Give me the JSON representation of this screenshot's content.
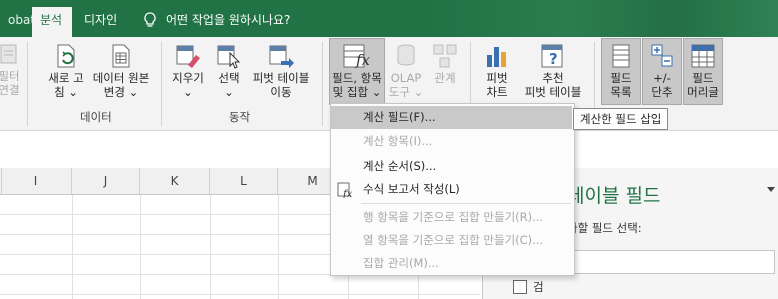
{
  "titlebar": {
    "tabs": [
      {
        "label": "obat"
      },
      {
        "label": "분석"
      },
      {
        "label": "디자인"
      }
    ],
    "search_text": "어떤 작업을 원하시나요?"
  },
  "ribbon": {
    "groups": {
      "data": "데이터",
      "actions": "동작"
    },
    "buttons": {
      "filter_conn_1": "필터",
      "filter_conn_2": "연결",
      "refresh_1": "새로 고",
      "refresh_2": "침 ⌄",
      "change_source_1": "데이터 원본",
      "change_source_2": "변경 ⌄",
      "clear_1": "지우기",
      "clear_2": "⌄",
      "select_1": "선택",
      "select_2": "⌄",
      "move_pivot_1": "피벗 테이블",
      "move_pivot_2": "이동",
      "fields_items_1": "필드, 항목",
      "fields_items_2": "및 집합 ⌄",
      "olap_1": "OLAP",
      "olap_2": "도구 ⌄",
      "relations": "관계",
      "pivot_chart_1": "피벗",
      "pivot_chart_2": "차트",
      "recommended_1": "추천",
      "recommended_2": "피벗 테이블",
      "field_list_1": "필드",
      "field_list_2": "목록",
      "buttons_1": "+/-",
      "buttons_2": "단추",
      "field_headers_1": "필드",
      "field_headers_2": "머리글"
    }
  },
  "columns": [
    "I",
    "J",
    "K",
    "L",
    "M"
  ],
  "pane": {
    "title": "테이블 필드",
    "subtitle": "가할 필드 선택:",
    "search_text": "검"
  },
  "menu": {
    "items": [
      {
        "label": "계산 필드(F)...",
        "enabled": true
      },
      {
        "label": "계산 항목(I)...",
        "enabled": false
      },
      {
        "label": "계산 순서(S)...",
        "enabled": true
      },
      {
        "label": "수식 보고서 작성(L)",
        "enabled": true
      },
      {
        "label": "행 항목을 기준으로 집합 만들기(R)...",
        "enabled": false
      },
      {
        "label": "열 항목을 기준으로 집합 만들기(C)...",
        "enabled": false
      },
      {
        "label": "집합 관리(M)...",
        "enabled": false
      }
    ]
  },
  "tooltip": "계산한 필드 삽입",
  "colors": {
    "title_green": "#217346",
    "pane_title_green": "#217346"
  }
}
